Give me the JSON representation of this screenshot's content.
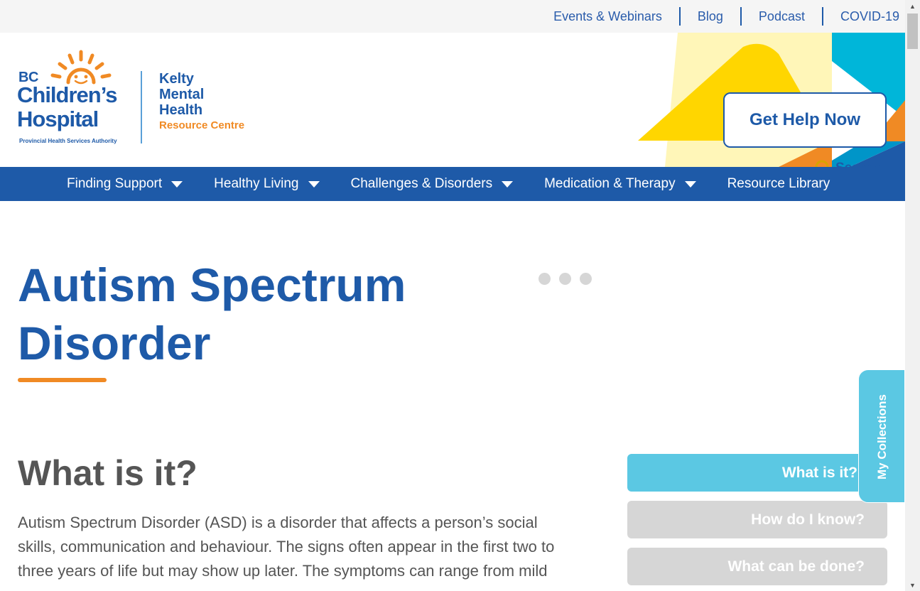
{
  "utility_nav": {
    "links": [
      "Events & Webinars",
      "Blog",
      "Podcast",
      "COVID-19"
    ]
  },
  "logo": {
    "bc": "BC",
    "childrens": "Children’s",
    "hospital": "Hospital",
    "authority": "Provincial Health Services Authority",
    "kelty_line1": "Kelty",
    "kelty_line2": "Mental",
    "kelty_line3": "Health",
    "resource_centre": "Resource Centre"
  },
  "header": {
    "help_button": "Get Help Now",
    "search_label": "Search"
  },
  "main_nav": {
    "items": [
      {
        "label": "Finding Support"
      },
      {
        "label": "Healthy Living"
      },
      {
        "label": "Challenges & Disorders"
      },
      {
        "label": "Medication & Therapy"
      },
      {
        "label": "Resource Library"
      }
    ]
  },
  "page": {
    "title_line1": "Autism Spectrum",
    "title_line2": "Disorder",
    "section_heading": "What is it?",
    "body": "Autism Spectrum Disorder (ASD) is a disorder that affects a person’s social skills, communication and behaviour. The signs often appear in the first two to three years of life but may show up later. The symptoms can range from mild"
  },
  "toc": {
    "items": [
      "What is it?",
      "How do I know?",
      "What can be done?"
    ],
    "active_index": 0
  },
  "collections_tab": {
    "label": "My Collections"
  },
  "colors": {
    "brand_blue": "#1e5aa8",
    "accent_orange": "#f08a24",
    "accent_cyan": "#5bc8e3",
    "accent_yellow": "#ffd600",
    "inactive_gray": "#d6d6d6"
  }
}
